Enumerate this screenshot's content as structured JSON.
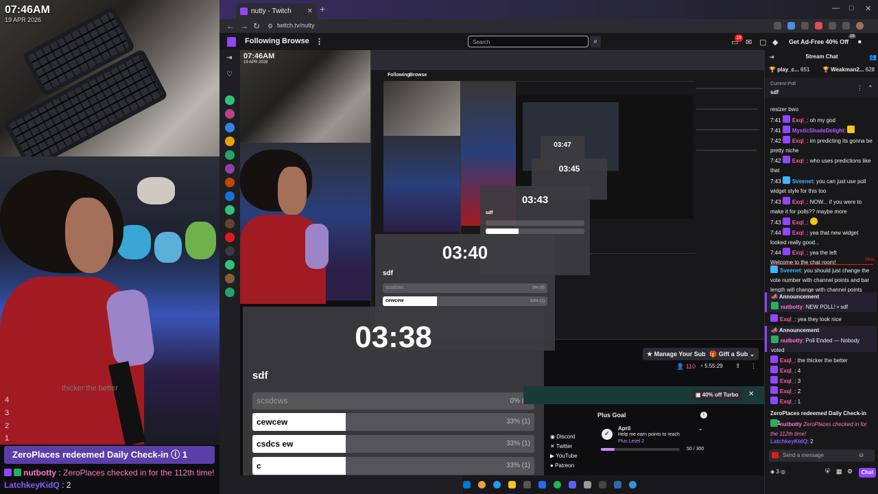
{
  "overlay": {
    "clock": "07:46AM",
    "date": "19 APR 2026",
    "countdown": [
      "4",
      "3",
      "2",
      "1"
    ],
    "faded_line": "thicker the better",
    "redeem_banner": "ZeroPlaces redeemed Daily Check-in ⓘ 1",
    "chat": [
      {
        "name": "nutbotty",
        "sep": " : ",
        "text": "ZeroPlaces checked in for the 112th time!",
        "name_color": "#ff79c6"
      },
      {
        "name": "LatchkeyKidQ",
        "sep": " : ",
        "text": "2",
        "name_color": "#8a5cff"
      }
    ]
  },
  "browser": {
    "tab_title": "nutty - Twitch",
    "url": "twitch.tv/nutty",
    "window_controls": [
      "—",
      "□",
      "✕"
    ]
  },
  "twitch": {
    "nav": [
      "Following",
      "Browse"
    ],
    "search_placeholder": "Search",
    "notification_count": "19",
    "ad_free": "Get Ad-Free 40% Off",
    "badge_count": "28"
  },
  "nested": {
    "clock": "07:46AM",
    "date": "19 APR 2026",
    "browse": [
      "Following",
      "Browse"
    ]
  },
  "polls": [
    {
      "time": "03:38",
      "question": "sdf",
      "options": [
        {
          "label": "scsdcws",
          "pct": "0% (0)",
          "value": 0
        },
        {
          "label": "cewcew",
          "pct": "33% (1)",
          "value": 33
        },
        {
          "label": "csdcs ew",
          "pct": "33% (1)",
          "value": 33
        },
        {
          "label": "c",
          "pct": "33% (1)",
          "value": 33
        }
      ]
    },
    {
      "time": "03:40",
      "question": "sdf",
      "options": [
        {
          "label": "scsdcws",
          "pct": "0% (0)",
          "value": 0
        },
        {
          "label": "cewcew",
          "pct": "33% (1)",
          "value": 33
        }
      ]
    },
    {
      "time": "03:43",
      "question": "sdf"
    },
    {
      "time": "03:45"
    },
    {
      "time": "03:47"
    }
  ],
  "stream_info": {
    "manage_sub": "Manage Your Sub",
    "gift_sub": "Gift a Sub",
    "viewers": "110",
    "uptime": "5:55:29",
    "turbo": "40% off Turbo"
  },
  "panels": {
    "links": [
      "Discord",
      "Twitter",
      "YouTube",
      "Patreon"
    ],
    "plus_goal_title": "Plus Goal",
    "goal_name": "April",
    "goal_desc": "Help me earn points to reach",
    "goal_level": "Plus Level 2",
    "goal_progress": "50 / 300",
    "goal_fraction": 0.17
  },
  "chat": {
    "header": "Stream Chat",
    "pinned": [
      {
        "name": "play_c...",
        "count": "651"
      },
      {
        "name": "Weakman2...",
        "count": "628"
      }
    ],
    "poll_label": "Current Poll",
    "poll_question": "sdf",
    "messages": [
      {
        "time": "",
        "name": "",
        "text": "resizer bwo"
      },
      {
        "time": "7:41",
        "name": "Exql_",
        "text": ": oh my god",
        "color": "#ff5aa5"
      },
      {
        "time": "7:41",
        "name": "MysticShadeDelight",
        "text": ":",
        "color": "#b05cff"
      },
      {
        "time": "7:42",
        "name": "Exql_",
        "text": ": im predicting its gonna be pretty niche",
        "color": "#ff5aa5"
      },
      {
        "time": "7:42",
        "name": "Exql_",
        "text": ": who uses predictions like that",
        "color": "#ff5aa5"
      },
      {
        "time": "7:43",
        "name": "Sveenet",
        "text": ": you can just use poll widget style for this too",
        "color": "#3fb6ff"
      },
      {
        "time": "7:43",
        "name": "Exql_",
        "text": ": NOW... if you were to make it for polls?? maybe more",
        "color": "#ff5aa5"
      },
      {
        "time": "7:43",
        "name": "Exql_",
        "text": ":",
        "color": "#ff5aa5"
      },
      {
        "time": "7:44",
        "name": "Exql_",
        "text": ": yea that new widget looked really good...",
        "color": "#ff5aa5"
      },
      {
        "time": "7:44",
        "name": "Exql_",
        "text": ": yea the left",
        "color": "#ff5aa5"
      }
    ],
    "welcome": "Welcome to the chat room!",
    "new_label": "New",
    "after": [
      {
        "name": "Sveenet",
        "text": ": you should just change the vote number with channel points and bar length will change with channel points",
        "color": "#3fb6ff"
      }
    ],
    "announcements": [
      {
        "title": "Announcement",
        "name": "nutbotty",
        "text": ": NEW POLL! • sdf"
      },
      {
        "title": "Announcement",
        "name": "nutbotty",
        "text": ": Poll Ended — Nobody voted"
      }
    ],
    "between": {
      "name": "Exql_",
      "text": ": yea they look nice"
    },
    "tail": [
      {
        "name": "Exql_",
        "text": ": the thicker the better",
        "color": "#ff5aa5"
      },
      {
        "name": "Exql_",
        "text": ": 4",
        "color": "#ff5aa5"
      },
      {
        "name": "Exql_",
        "text": ": 3",
        "color": "#ff5aa5"
      },
      {
        "name": "Exql_",
        "text": ": 2",
        "color": "#ff5aa5"
      },
      {
        "name": "Exql_",
        "text": ": 1",
        "color": "#ff5aa5"
      }
    ],
    "redeem": "ZeroPlaces redeemed Daily Check-in",
    "redeem_count": "1",
    "bot_line_name": "nutbotty",
    "bot_line_text": " ZeroPlaces checked in for the 112th time!",
    "last_name": "LatchkeyKidQ",
    "last_text": ": 2",
    "input_placeholder": "Send a message",
    "points": "3",
    "chat_button": "Chat"
  },
  "colors": {
    "twitch_purple": "#9146ff",
    "live_red": "#e91916"
  }
}
